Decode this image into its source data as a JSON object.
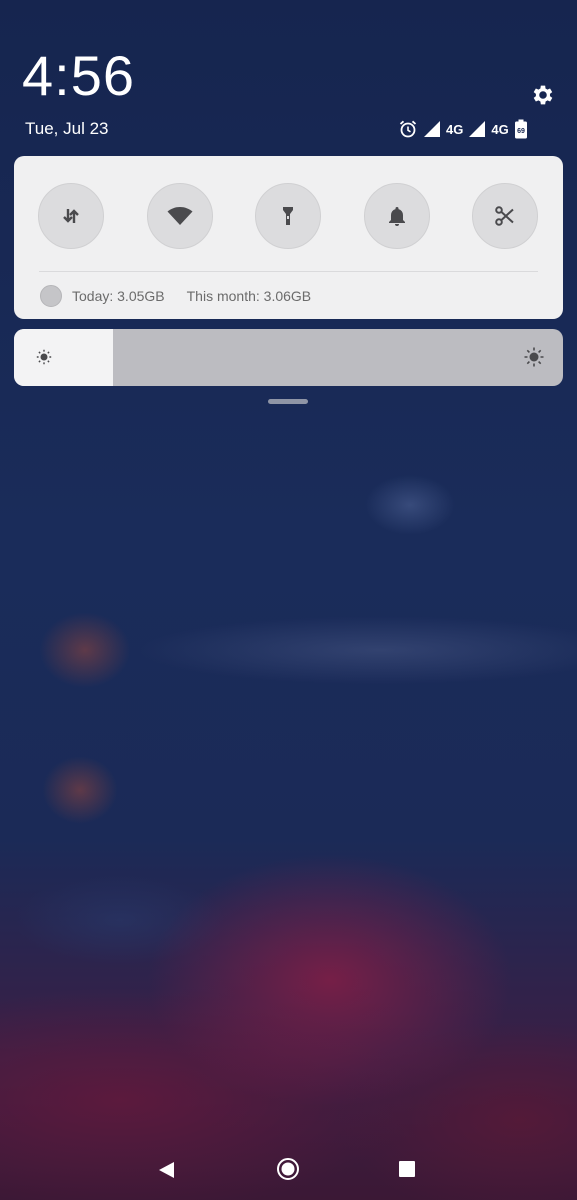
{
  "header": {
    "time": "4:56",
    "date": "Tue, Jul 23"
  },
  "status_bar": {
    "alarm_icon": "alarm-clock-icon",
    "sim1_network": "4G",
    "sim2_network": "4G",
    "battery_level": "69"
  },
  "quick_settings": {
    "toggles": [
      {
        "name": "mobile-data",
        "icon": "data-arrows-icon"
      },
      {
        "name": "wifi",
        "icon": "wifi-icon"
      },
      {
        "name": "flashlight",
        "icon": "flashlight-icon"
      },
      {
        "name": "sound",
        "icon": "bell-icon"
      },
      {
        "name": "screenshot",
        "icon": "scissors-icon"
      }
    ],
    "data_usage": {
      "today": "Today: 3.05GB",
      "month": "This month: 3.06GB"
    }
  },
  "brightness": {
    "level_fraction": 0.18
  },
  "colors": {
    "panel_bg": "#f0f0f1",
    "toggle_bg": "#dcdcde",
    "icon_dark": "#4a4a4d",
    "wallpaper_top": "#16254f",
    "wallpaper_bottom": "#3b1835"
  }
}
